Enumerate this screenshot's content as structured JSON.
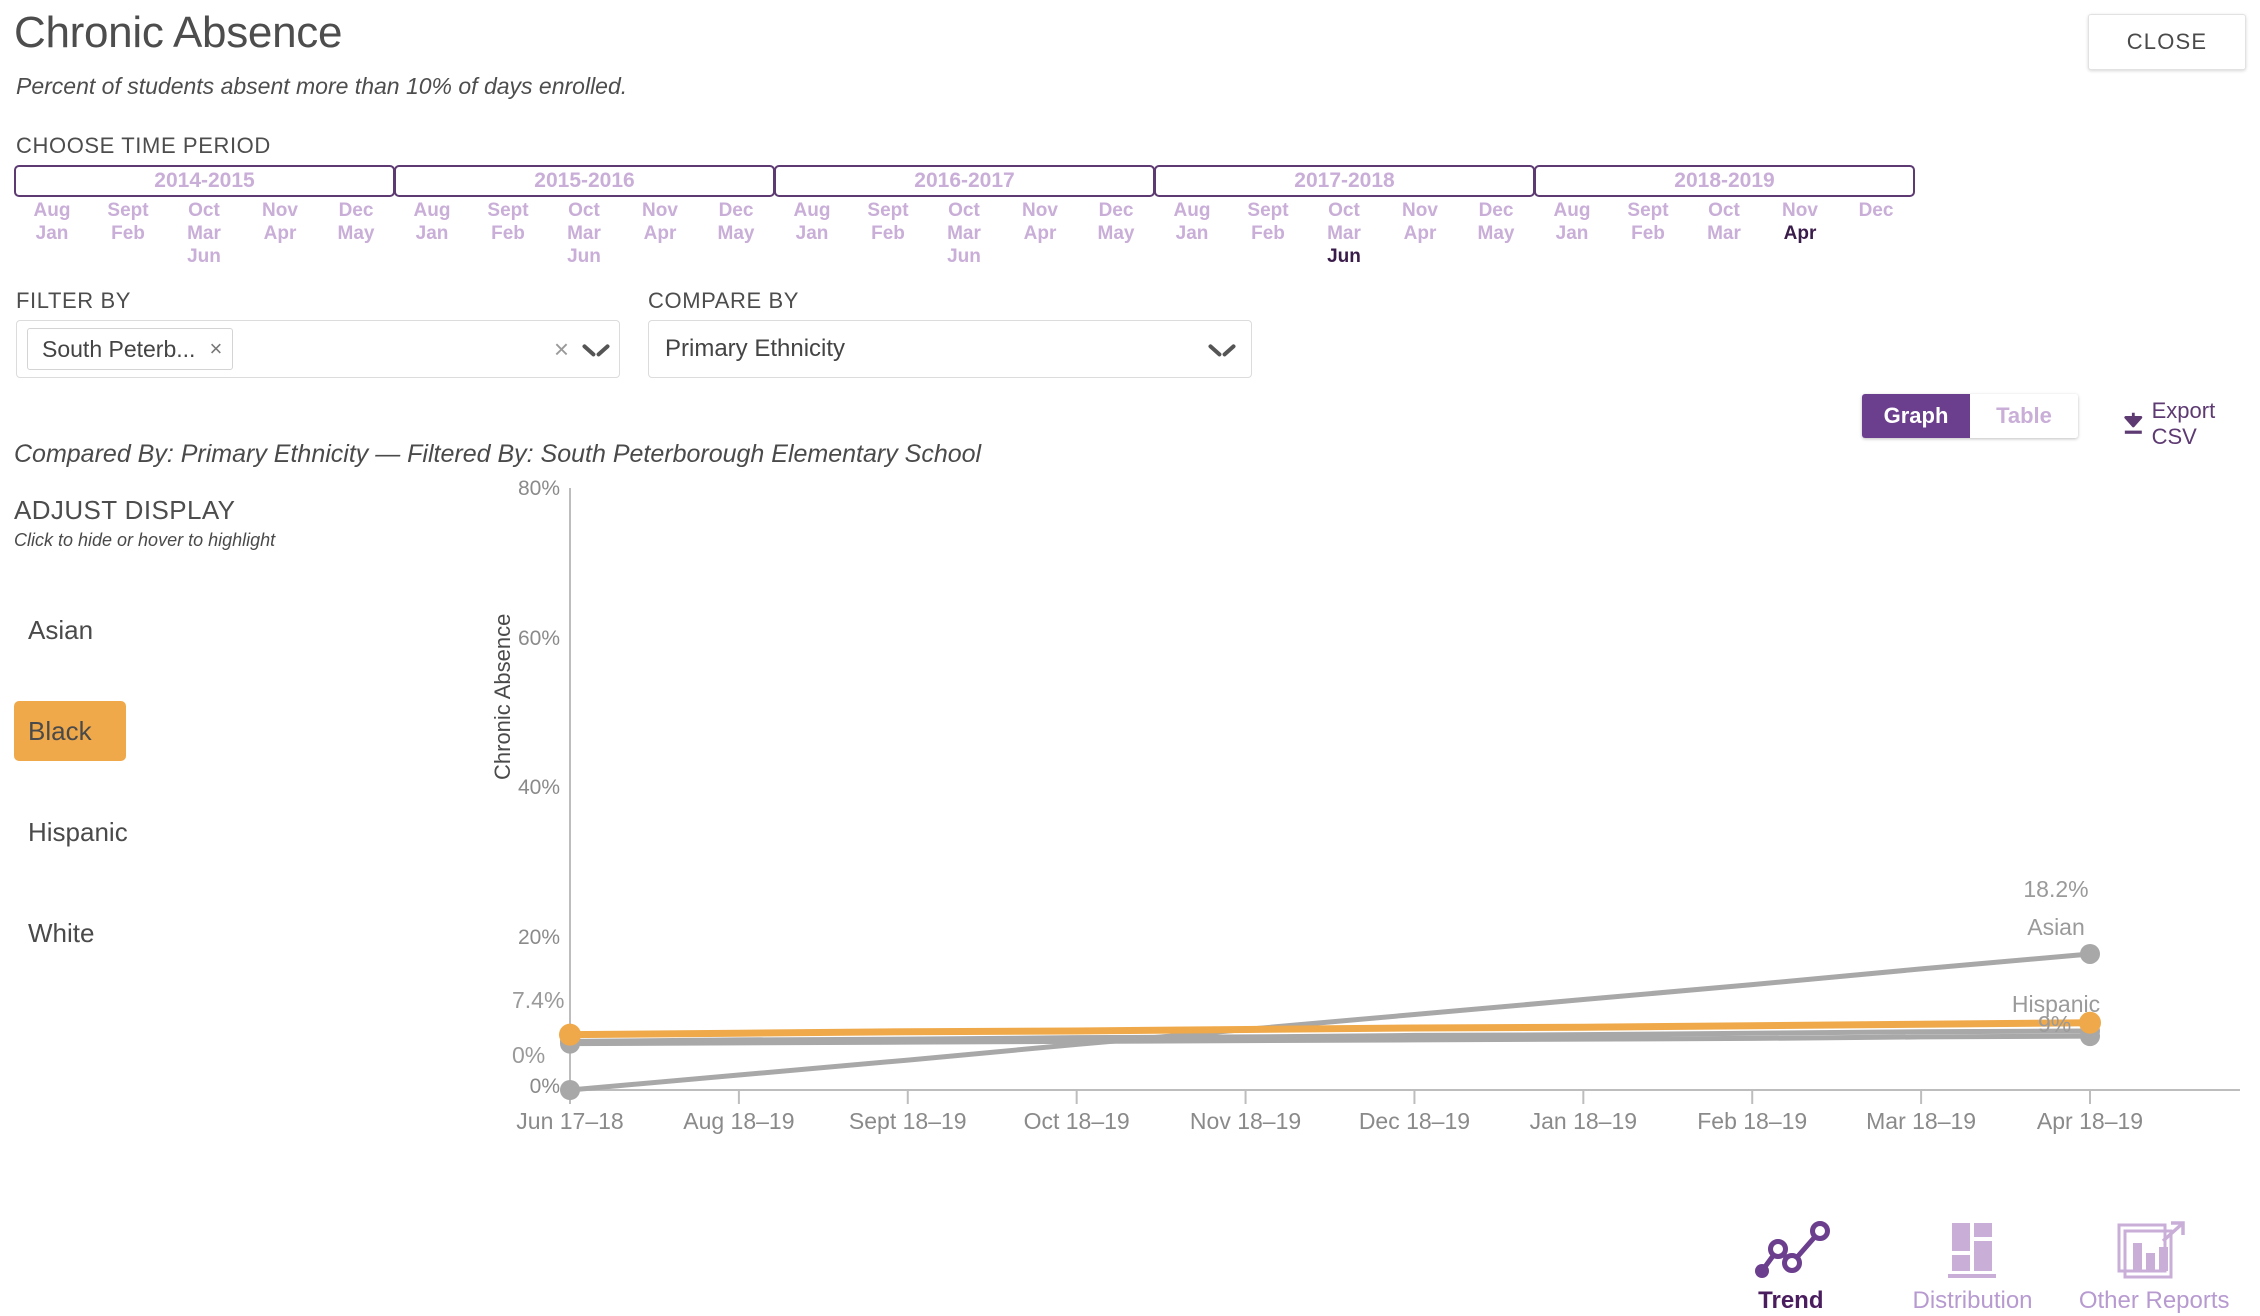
{
  "header": {
    "title": "Chronic Absence",
    "subtitle": "Percent of students absent more than 10% of days enrolled.",
    "close_label": "CLOSE"
  },
  "time_period": {
    "label": "CHOOSE TIME PERIOD",
    "years": [
      {
        "label": "2014-2015",
        "columns": [
          {
            "months": [
              "Aug",
              "Jan"
            ],
            "selected": []
          },
          {
            "months": [
              "Sept",
              "Feb"
            ],
            "selected": []
          },
          {
            "months": [
              "Oct",
              "Mar",
              "Jun"
            ],
            "selected": []
          },
          {
            "months": [
              "Nov",
              "Apr"
            ],
            "selected": []
          },
          {
            "months": [
              "Dec",
              "May"
            ],
            "selected": []
          }
        ]
      },
      {
        "label": "2015-2016",
        "columns": [
          {
            "months": [
              "Aug",
              "Jan"
            ],
            "selected": []
          },
          {
            "months": [
              "Sept",
              "Feb"
            ],
            "selected": []
          },
          {
            "months": [
              "Oct",
              "Mar",
              "Jun"
            ],
            "selected": []
          },
          {
            "months": [
              "Nov",
              "Apr"
            ],
            "selected": []
          },
          {
            "months": [
              "Dec",
              "May"
            ],
            "selected": []
          }
        ]
      },
      {
        "label": "2016-2017",
        "columns": [
          {
            "months": [
              "Aug",
              "Jan"
            ],
            "selected": []
          },
          {
            "months": [
              "Sept",
              "Feb"
            ],
            "selected": []
          },
          {
            "months": [
              "Oct",
              "Mar",
              "Jun"
            ],
            "selected": []
          },
          {
            "months": [
              "Nov",
              "Apr"
            ],
            "selected": []
          },
          {
            "months": [
              "Dec",
              "May"
            ],
            "selected": []
          }
        ]
      },
      {
        "label": "2017-2018",
        "columns": [
          {
            "months": [
              "Aug",
              "Jan"
            ],
            "selected": []
          },
          {
            "months": [
              "Sept",
              "Feb"
            ],
            "selected": []
          },
          {
            "months": [
              "Oct",
              "Mar",
              "Jun"
            ],
            "selected": [
              "Jun"
            ]
          },
          {
            "months": [
              "Nov",
              "Apr"
            ],
            "selected": []
          },
          {
            "months": [
              "Dec",
              "May"
            ],
            "selected": []
          }
        ]
      },
      {
        "label": "2018-2019",
        "columns": [
          {
            "months": [
              "Aug",
              "Jan"
            ],
            "selected": []
          },
          {
            "months": [
              "Sept",
              "Feb"
            ],
            "selected": []
          },
          {
            "months": [
              "Oct",
              "Mar"
            ],
            "selected": []
          },
          {
            "months": [
              "Nov",
              "Apr"
            ],
            "selected": [
              "Apr"
            ]
          },
          {
            "months": [
              "Dec"
            ],
            "selected": []
          }
        ]
      }
    ]
  },
  "filter": {
    "label": "FILTER BY",
    "chips": [
      "South Peterb..."
    ],
    "chip_remove": "×",
    "clear_all": "×"
  },
  "compare": {
    "label": "COMPARE BY",
    "value": "Primary Ethnicity"
  },
  "view_toggle": {
    "graph_label": "Graph",
    "table_label": "Table",
    "active": "Graph"
  },
  "export": {
    "label": "Export CSV",
    "icon": "download-icon"
  },
  "summary_line": "Compared By: Primary Ethnicity — Filtered By: South Peterborough Elementary School",
  "adjust_display": {
    "title": "ADJUST DISPLAY",
    "hint": "Click to hide or hover to highlight",
    "items": [
      {
        "label": "Asian",
        "highlighted": false
      },
      {
        "label": "Black",
        "highlighted": true
      },
      {
        "label": "Hispanic",
        "highlighted": false
      },
      {
        "label": "White",
        "highlighted": false
      }
    ]
  },
  "colors": {
    "accent_purple": "#6b3e8e",
    "light_purple": "#c9aed8",
    "highlight_orange": "#efa котор",
    "series_gray": "#a8a8a8"
  },
  "chart_data": {
    "type": "line",
    "title": "",
    "xlabel": "",
    "ylabel": "Chronic Absence",
    "ylim": [
      0,
      80
    ],
    "yticks": [
      "0%",
      "20%",
      "40%",
      "60%",
      "80%"
    ],
    "ytick_values": [
      0,
      20,
      40,
      60,
      80
    ],
    "grid": false,
    "legend_position": "left",
    "x": [
      "Jun 17–18",
      "Aug 18–19",
      "Sept 18–19",
      "Oct 18–19",
      "Nov 18–19",
      "Dec 18–19",
      "Jan 18–19",
      "Feb 18–19",
      "Mar 18–19",
      "Apr 18–19"
    ],
    "series": [
      {
        "name": "Asian",
        "color": "#a8a8a8",
        "highlighted": false,
        "start_label": "0%",
        "end_label": "18.2%",
        "end_name_label": "Asian",
        "values": [
          0,
          2.0,
          4.0,
          6.1,
          8.1,
          10.1,
          12.1,
          14.1,
          16.2,
          18.2
        ]
      },
      {
        "name": "Black",
        "color": "#efa котор",
        "highlighted": true,
        "start_label": "7.4%",
        "end_label": "9%",
        "end_name_label": "",
        "values": [
          7.4,
          7.6,
          7.8,
          7.9,
          8.1,
          8.3,
          8.4,
          8.6,
          8.8,
          9.0
        ]
      },
      {
        "name": "Hispanic",
        "color": "#a8a8a8",
        "highlighted": false,
        "start_label": "",
        "end_label": "",
        "end_name_label": "Hispanic",
        "values": [
          6.5,
          6.7,
          6.8,
          7.0,
          7.1,
          7.3,
          7.4,
          7.6,
          7.8,
          7.9
        ]
      },
      {
        "name": "White",
        "color": "#a8a8a8",
        "highlighted": false,
        "start_label": "",
        "end_label": "",
        "end_name_label": "",
        "values": [
          6.2,
          6.3,
          6.4,
          6.5,
          6.6,
          6.7,
          6.8,
          6.9,
          7.1,
          7.2
        ]
      }
    ]
  },
  "bottom_nav": {
    "items": [
      {
        "label": "Trend",
        "icon": "trend-line-icon",
        "active": true
      },
      {
        "label": "Distribution",
        "icon": "distribution-bars-icon",
        "active": false
      },
      {
        "label": "Other Reports",
        "icon": "other-reports-icon",
        "active": false
      }
    ]
  }
}
